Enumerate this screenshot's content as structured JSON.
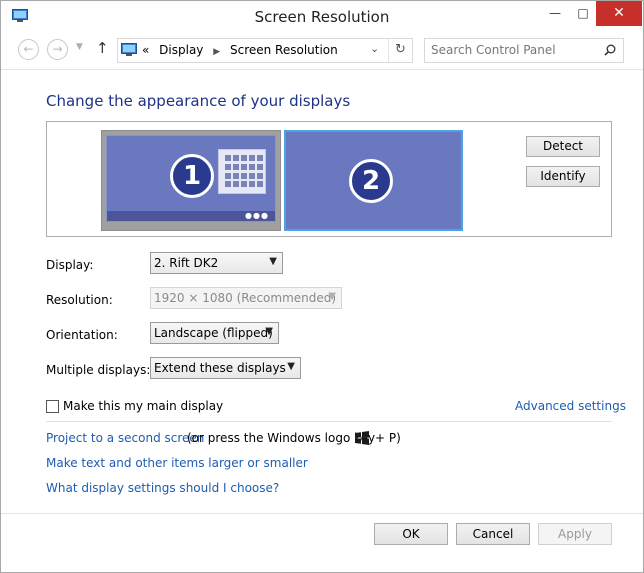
{
  "window": {
    "title": "Screen Resolution",
    "minimize": "—",
    "maximize": "□",
    "close": "✕"
  },
  "address_bar": {
    "prefix": "«",
    "crumbs": [
      "Display",
      "Screen Resolution"
    ],
    "search_placeholder": "Search Control Panel"
  },
  "main": {
    "heading": "Change the appearance of your displays",
    "monitors": [
      {
        "number": "1"
      },
      {
        "number": "2"
      }
    ],
    "detect_label": "Detect",
    "identify_label": "Identify",
    "display_label": "Display:",
    "display_value": "2. Rift DK2",
    "resolution_label": "Resolution:",
    "resolution_value": "1920 × 1080 (Recommended)",
    "orientation_label": "Orientation:",
    "orientation_value": "Landscape (flipped)",
    "multiple_label": "Multiple displays:",
    "multiple_value": "Extend these displays",
    "main_display_label": "Make this my main display",
    "advanced_link": "Advanced settings",
    "project_link": "Project to a second screen",
    "project_note_a": "(or press the Windows logo key",
    "project_note_b": "+ P)",
    "text_size_link": "Make text and other items larger or smaller",
    "help_link": "What display settings should I choose?"
  },
  "footer": {
    "ok": "OK",
    "cancel": "Cancel",
    "apply": "Apply"
  },
  "colors": {
    "heading": "#1e3287",
    "link": "#1f5cb0",
    "monitor": "#6a78c0",
    "selected_border": "#4aa3e3",
    "close_button": "#c7302a"
  }
}
